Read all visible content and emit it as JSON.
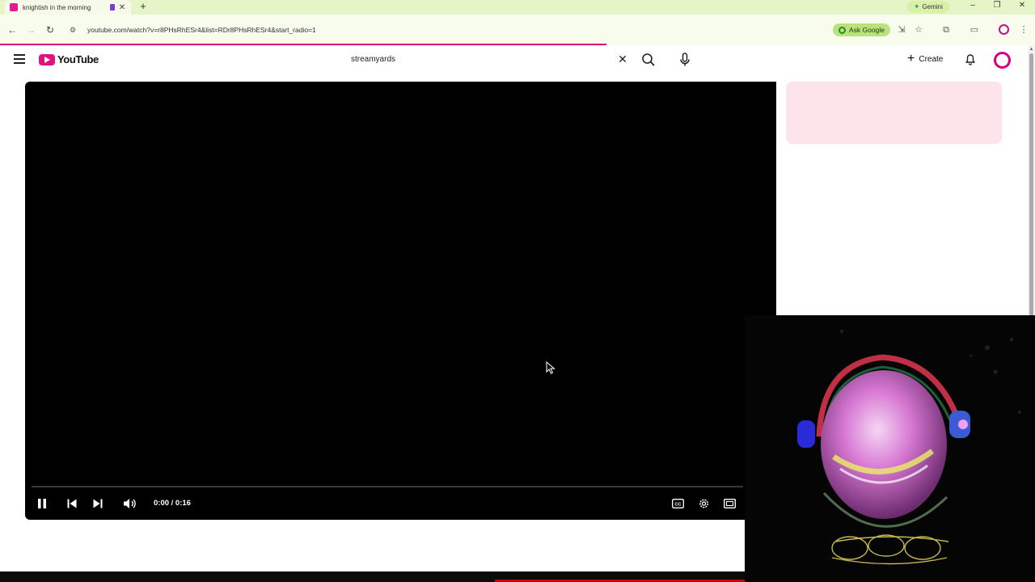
{
  "browser": {
    "tab": {
      "title": "knightish in the morning",
      "close_icon": "close-icon"
    },
    "gemini_label": "Gemini",
    "url": "youtube.com/watch?v=r8PHsRhESr4&list=RDr8PHsRhESr4&start_radio=1",
    "ask_google_label": "Ask Google",
    "colors": {
      "tabstrip": "#e6f5c8",
      "toolbar": "#f7fcec",
      "accent": "#d6007e"
    }
  },
  "youtube": {
    "logo_text": "YouTube",
    "search": {
      "value": "streamyards"
    },
    "create_label": "Create",
    "brand_color": "#e1117f"
  },
  "player": {
    "time_display": "0:00 / 0:16",
    "progress_fraction": 0.0,
    "controls": [
      "pause-icon",
      "previous-icon",
      "next-icon",
      "volume-icon",
      "captions-icon",
      "settings-icon",
      "theater-icon"
    ]
  }
}
